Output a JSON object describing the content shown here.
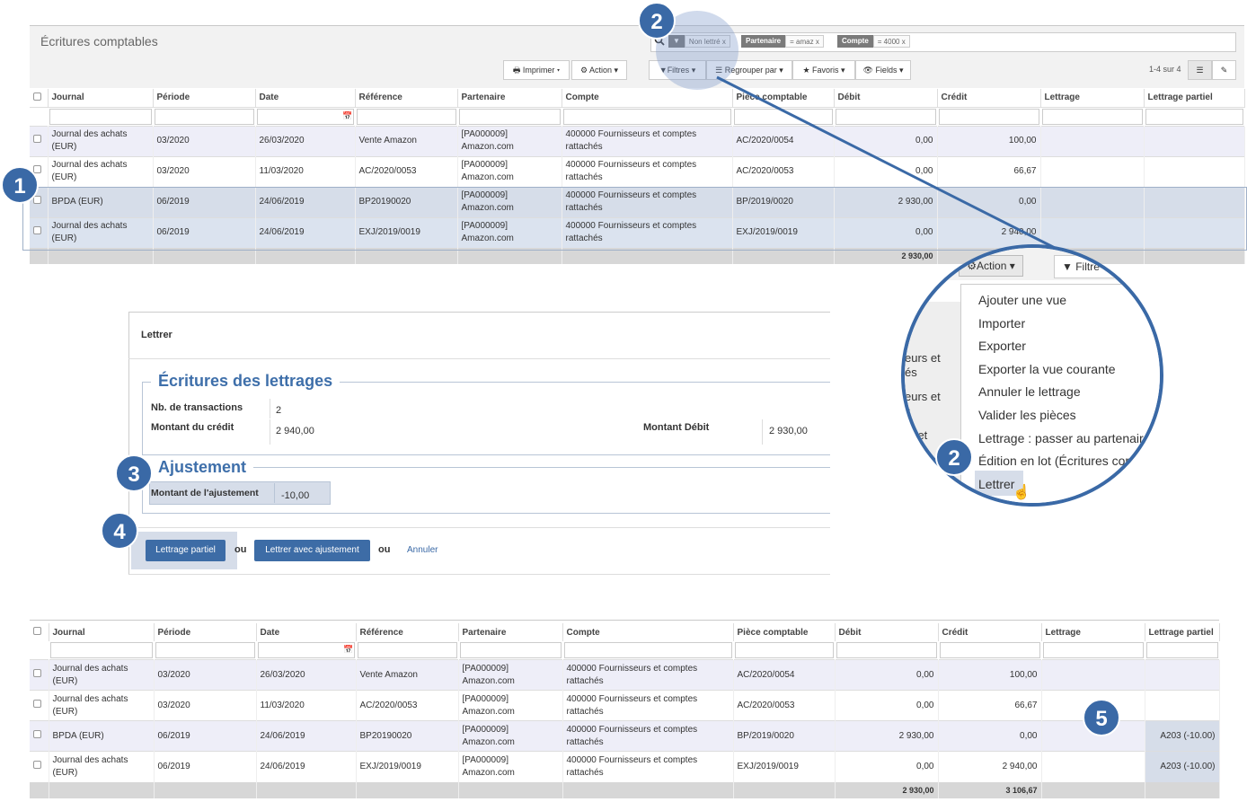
{
  "page_title": "Écritures comptables",
  "search": {
    "facets": [
      {
        "key": "",
        "value": "Non lettré",
        "close": "x"
      },
      {
        "key": "Partenaire",
        "value": "= amaz",
        "close": "x"
      },
      {
        "key": "Compte",
        "value": "= 4000",
        "close": "x"
      }
    ]
  },
  "toolbar": {
    "print": "Imprimer",
    "action": "Action",
    "filters": "Filtres",
    "group_by": "Regrouper par",
    "favorites": "Favoris",
    "fields": "Fields",
    "pager": "1-4 sur 4"
  },
  "columns": [
    "Journal",
    "Période",
    "Date",
    "Référence",
    "Partenaire",
    "Compte",
    "Pièce comptable",
    "Débit",
    "Crédit",
    "Lettrage",
    "Lettrage partiel"
  ],
  "rows_top": [
    {
      "journal": "Journal des achats (EUR)",
      "periode": "03/2020",
      "date": "26/03/2020",
      "ref": "Vente Amazon",
      "partner": "[PA000009] Amazon.com",
      "compte": "400000 Fournisseurs et comptes rattachés",
      "piece": "AC/2020/0054",
      "debit": "0,00",
      "credit": "100,00",
      "lettrage": "",
      "partiel": ""
    },
    {
      "journal": "Journal des achats (EUR)",
      "periode": "03/2020",
      "date": "11/03/2020",
      "ref": "AC/2020/0053",
      "partner": "[PA000009] Amazon.com",
      "compte": "400000 Fournisseurs et comptes rattachés",
      "piece": "AC/2020/0053",
      "debit": "0,00",
      "credit": "66,67",
      "lettrage": "",
      "partiel": ""
    },
    {
      "journal": "BPDA (EUR)",
      "periode": "06/2019",
      "date": "24/06/2019",
      "ref": "BP20190020",
      "partner": "[PA000009] Amazon.com",
      "compte": "400000 Fournisseurs et comptes rattachés",
      "piece": "BP/2019/0020",
      "debit": "2 930,00",
      "credit": "0,00",
      "lettrage": "",
      "partiel": ""
    },
    {
      "journal": "Journal des achats (EUR)",
      "periode": "06/2019",
      "date": "24/06/2019",
      "ref": "EXJ/2019/0019",
      "partner": "[PA000009] Amazon.com",
      "compte": "400000 Fournisseurs et comptes rattachés",
      "piece": "EXJ/2019/0019",
      "debit": "0,00",
      "credit": "2 940,00",
      "lettrage": "",
      "partiel": ""
    }
  ],
  "totals_top": {
    "debit": "2 930,00",
    "credit": ""
  },
  "dialog": {
    "title": "Lettrer",
    "section1": "Écritures des lettrages",
    "nb_label": "Nb. de transactions",
    "nb_value": "2",
    "credit_label": "Montant du crédit",
    "credit_value": "2 940,00",
    "debit_label": "Montant Débit",
    "debit_value": "2 930,00",
    "section2": "Ajustement",
    "adj_label": "Montant de l'ajustement",
    "adj_value": "-10,00",
    "btn_partial": "Lettrage partiel",
    "or1": "ou",
    "btn_adjust": "Lettrer avec ajustement",
    "or2": "ou",
    "cancel": "Annuler"
  },
  "rows_bottom": [
    {
      "journal": "Journal des achats (EUR)",
      "periode": "03/2020",
      "date": "26/03/2020",
      "ref": "Vente Amazon",
      "partner": "[PA000009] Amazon.com",
      "compte": "400000 Fournisseurs et comptes rattachés",
      "piece": "AC/2020/0054",
      "debit": "0,00",
      "credit": "100,00",
      "lettrage": "",
      "partiel": ""
    },
    {
      "journal": "Journal des achats (EUR)",
      "periode": "03/2020",
      "date": "11/03/2020",
      "ref": "AC/2020/0053",
      "partner": "[PA000009] Amazon.com",
      "compte": "400000 Fournisseurs et comptes rattachés",
      "piece": "AC/2020/0053",
      "debit": "0,00",
      "credit": "66,67",
      "lettrage": "",
      "partiel": ""
    },
    {
      "journal": "BPDA (EUR)",
      "periode": "06/2019",
      "date": "24/06/2019",
      "ref": "BP20190020",
      "partner": "[PA000009] Amazon.com",
      "compte": "400000 Fournisseurs et comptes rattachés",
      "piece": "BP/2019/0020",
      "debit": "2 930,00",
      "credit": "0,00",
      "lettrage": "",
      "partiel": "A203 (-10.00)"
    },
    {
      "journal": "Journal des achats (EUR)",
      "periode": "06/2019",
      "date": "24/06/2019",
      "ref": "EXJ/2019/0019",
      "partner": "[PA000009] Amazon.com",
      "compte": "400000 Fournisseurs et comptes rattachés",
      "piece": "EXJ/2019/0019",
      "debit": "0,00",
      "credit": "2 940,00",
      "lettrage": "",
      "partiel": "A203 (-10.00)"
    }
  ],
  "totals_bottom": {
    "debit": "2 930,00",
    "credit": "3 106,67"
  },
  "zoom": {
    "action": "Action",
    "filters": "Filtre",
    "menu": [
      "Ajouter une vue",
      "Importer",
      "Exporter",
      "Exporter la vue courante",
      "Annuler le lettrage",
      "Valider les pièces",
      "Lettrage : passer au partenaire",
      "Édition en lot (Écritures com",
      "Lettrer"
    ],
    "side_fragments": [
      "eurs et",
      "és",
      "eurs et",
      "s",
      "rs et"
    ]
  },
  "badges": [
    "1",
    "2",
    "2",
    "3",
    "4",
    "5"
  ],
  "colors": {
    "accent": "#3a69a6",
    "button": "#3d6ca6",
    "highlight": "#d6dde9"
  }
}
